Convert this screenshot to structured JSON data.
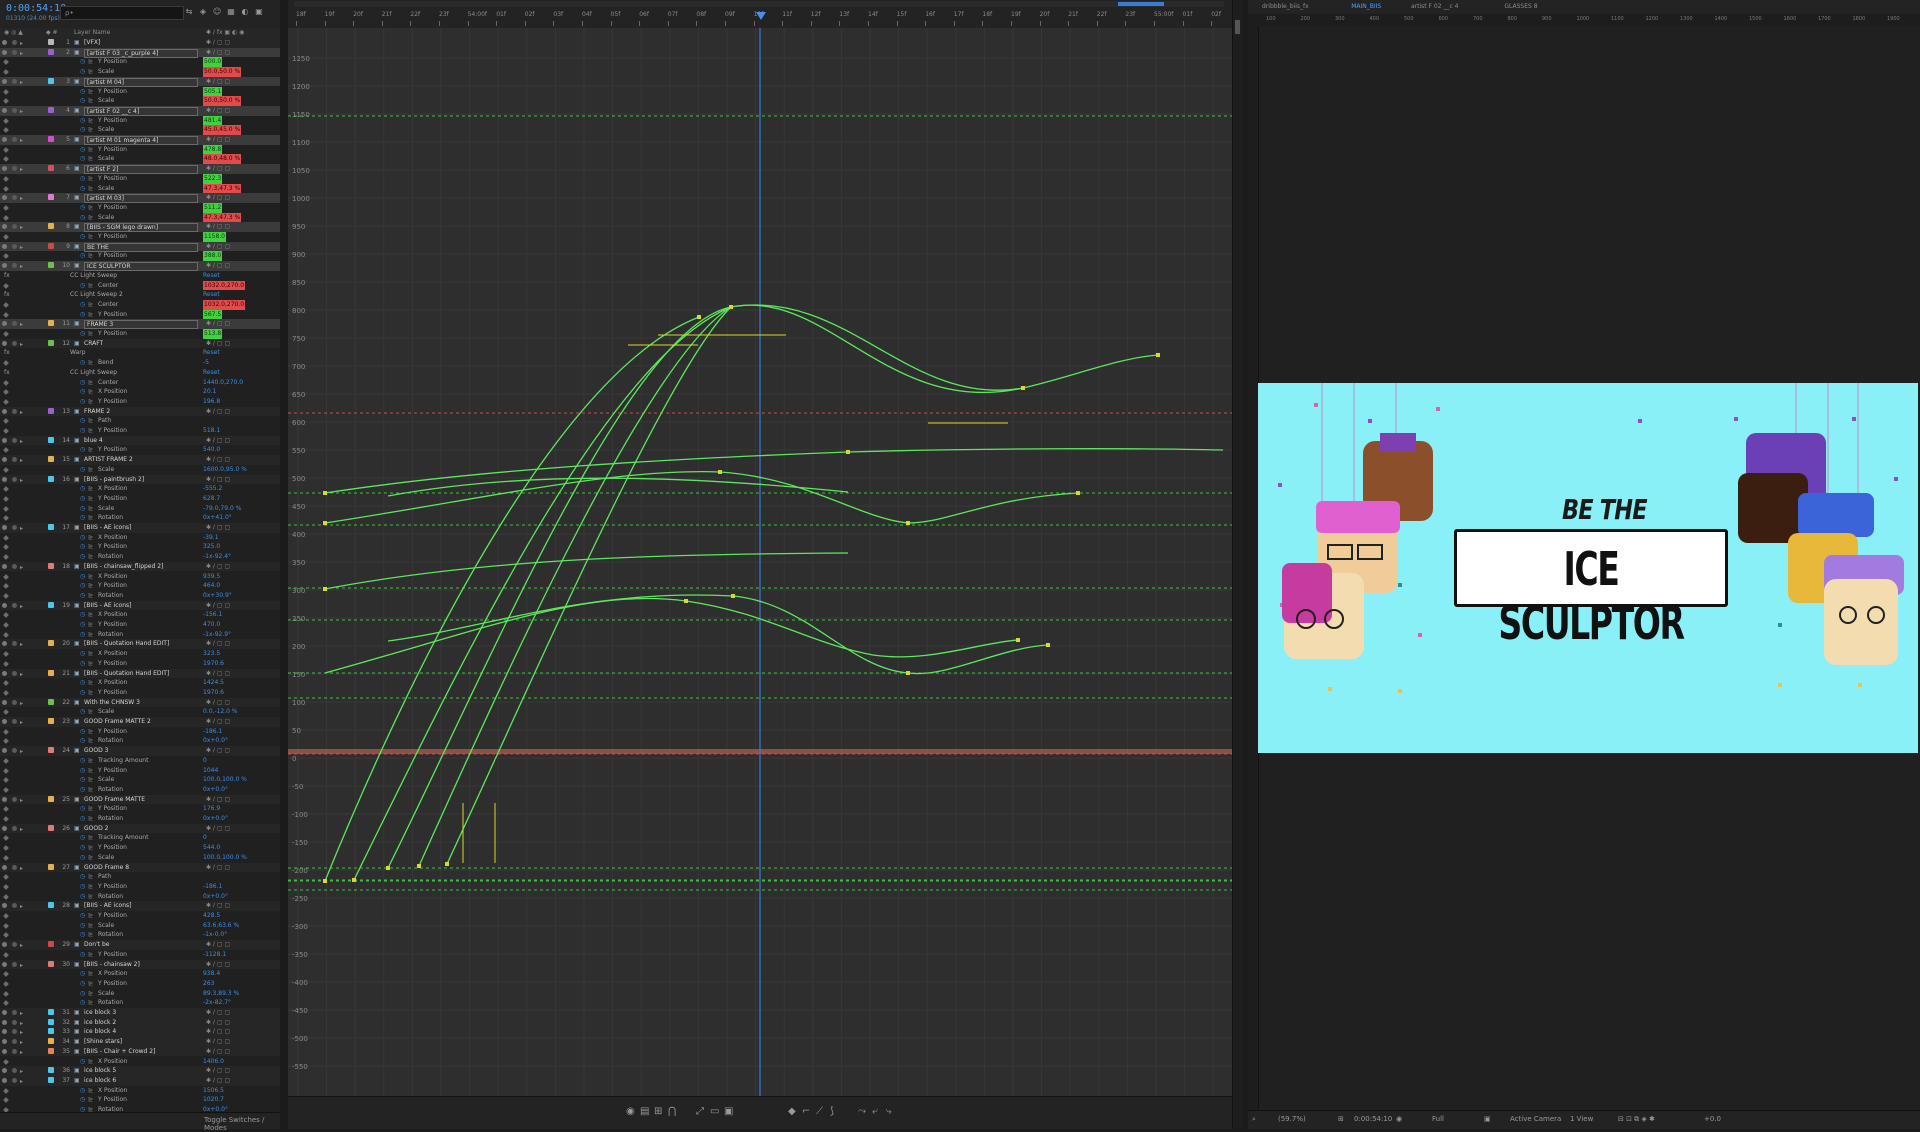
{
  "header": {
    "timecode": "0:00:54:10",
    "frame_label": "01310 (24.00 fps)",
    "search_placeholder": "ρ•",
    "column_label": "Layer Name",
    "toggle_label": "Toggle Switches / Modes"
  },
  "layers": [
    {
      "type": "layer",
      "num": "1",
      "name": "[VFX]",
      "color": "#b8b8b8",
      "boxed": false
    },
    {
      "type": "layer",
      "num": "2",
      "name": "[artist F 03 _c_purple 4]",
      "color": "#9a5fd1",
      "boxed": true,
      "sel": true
    },
    {
      "type": "prop",
      "name": "Y Position",
      "value": "500.0",
      "hl": "g"
    },
    {
      "type": "prop",
      "name": "Scale",
      "value": "50.0,50.0 %",
      "hl": "r"
    },
    {
      "type": "layer",
      "num": "3",
      "name": "[artist M 04]",
      "color": "#4dc7e8",
      "boxed": true,
      "sel": true
    },
    {
      "type": "prop",
      "name": "Y Position",
      "value": "505.1",
      "hl": "g"
    },
    {
      "type": "prop",
      "name": "Scale",
      "value": "50.0,50.0 %",
      "hl": "r"
    },
    {
      "type": "layer",
      "num": "4",
      "name": "[artist F 02 __c 4]",
      "color": "#9a5fd1",
      "boxed": true,
      "sel": true
    },
    {
      "type": "prop",
      "name": "Y Position",
      "value": "481.4",
      "hl": "g"
    },
    {
      "type": "prop",
      "name": "Scale",
      "value": "45.0,45.0 %",
      "hl": "r"
    },
    {
      "type": "layer",
      "num": "5",
      "name": "[artist M 01 magenta 4]",
      "color": "#d24fd2",
      "boxed": true,
      "sel": true
    },
    {
      "type": "prop",
      "name": "Y Position",
      "value": "478.8",
      "hl": "g"
    },
    {
      "type": "prop",
      "name": "Scale",
      "value": "48.0,48.0 %",
      "hl": "r"
    },
    {
      "type": "layer",
      "num": "6",
      "name": "[artist F 2]",
      "color": "#d14f5f",
      "boxed": true,
      "sel": true
    },
    {
      "type": "prop",
      "name": "Y Position",
      "value": "522.3",
      "hl": "g"
    },
    {
      "type": "prop",
      "name": "Scale",
      "value": "47.3,47.3 %",
      "hl": "r"
    },
    {
      "type": "layer",
      "num": "7",
      "name": "[artist M 03]",
      "color": "#e07ad2",
      "boxed": true,
      "sel": true
    },
    {
      "type": "prop",
      "name": "Y Position",
      "value": "511.2",
      "hl": "g"
    },
    {
      "type": "prop",
      "name": "Scale",
      "value": "47.3,47.3 %",
      "hl": "r"
    },
    {
      "type": "layer",
      "num": "8",
      "name": "[BIIS - SGM lego drawn]",
      "color": "#e8b04d",
      "boxed": true,
      "sel": true
    },
    {
      "type": "prop",
      "name": "Y Position",
      "value": "1158.0",
      "hl": "g"
    },
    {
      "type": "layer",
      "num": "9",
      "name": "BE THE",
      "color": "#c84a4a",
      "boxed": true,
      "sel": true
    },
    {
      "type": "prop",
      "name": "Y Position",
      "value": "388.0",
      "hl": "g"
    },
    {
      "type": "layer",
      "num": "10",
      "name": "ICE SCULPTOR",
      "color": "#6fc04b",
      "boxed": true,
      "sel": true
    },
    {
      "type": "fx",
      "name": "CC Light Sweep",
      "value": "Reset"
    },
    {
      "type": "prop",
      "name": "Center",
      "value": "1032.0,270.0",
      "hl": "rg"
    },
    {
      "type": "fx",
      "name": "CC Light Sweep 2",
      "value": "Reset"
    },
    {
      "type": "prop",
      "name": "Center",
      "value": "1032.0,270.0",
      "hl": "rg"
    },
    {
      "type": "prop",
      "name": "Y Position",
      "value": "567.5",
      "hl": "g"
    },
    {
      "type": "layer",
      "num": "11",
      "name": "FRAME 3",
      "color": "#e8b04d",
      "boxed": true,
      "sel": true
    },
    {
      "type": "prop",
      "name": "Y Position",
      "value": "513.8",
      "hl": "g"
    },
    {
      "type": "layer",
      "num": "12",
      "name": "CRAFT",
      "color": "#6fc04b",
      "boxed": false
    },
    {
      "type": "fx",
      "name": "Warp",
      "value": "Reset"
    },
    {
      "type": "prop",
      "name": "Bend",
      "value": "-5"
    },
    {
      "type": "fx",
      "name": "CC Light Sweep",
      "value": "Reset"
    },
    {
      "type": "prop",
      "name": "Center",
      "value": "1440.0,270.0"
    },
    {
      "type": "prop",
      "name": "X Position",
      "value": "20.1"
    },
    {
      "type": "prop",
      "name": "Y Position",
      "value": "196.8"
    },
    {
      "type": "layer",
      "num": "13",
      "name": "FRAME 2",
      "color": "#9a5fd1",
      "boxed": false
    },
    {
      "type": "prop",
      "name": "Path",
      "value": ""
    },
    {
      "type": "prop",
      "name": "Y Position",
      "value": "518.1"
    },
    {
      "type": "layer",
      "num": "14",
      "name": "blue 4",
      "color": "#4dc7e8",
      "boxed": false
    },
    {
      "type": "prop",
      "name": "Y Position",
      "value": "540.0"
    },
    {
      "type": "layer",
      "num": "15",
      "name": "ARTIST FRAME 2",
      "color": "#e8b04d",
      "boxed": false
    },
    {
      "type": "prop",
      "name": "Scale",
      "value": "1600.0,95.0 %"
    },
    {
      "type": "layer",
      "num": "16",
      "name": "[BIIS - paintbrush 2]",
      "color": "#4dc7e8",
      "boxed": false
    },
    {
      "type": "prop",
      "name": "X Position",
      "value": "-555.2"
    },
    {
      "type": "prop",
      "name": "Y Position",
      "value": "628.7"
    },
    {
      "type": "prop",
      "name": "Scale",
      "value": "-79.0,79.0 %"
    },
    {
      "type": "prop",
      "name": "Rotation",
      "value": "0x+41.0°"
    },
    {
      "type": "layer",
      "num": "17",
      "name": "[BIIS - AE icons]",
      "color": "#4dc7e8",
      "boxed": false
    },
    {
      "type": "prop",
      "name": "X Position",
      "value": "-39.1"
    },
    {
      "type": "prop",
      "name": "Y Position",
      "value": "325.0"
    },
    {
      "type": "prop",
      "name": "Rotation",
      "value": "-1x-92.4°"
    },
    {
      "type": "layer",
      "num": "18",
      "name": "[BIIS - chainsaw_flipped 2]",
      "color": "#e07a7a",
      "boxed": false
    },
    {
      "type": "prop",
      "name": "X Position",
      "value": "939.5"
    },
    {
      "type": "prop",
      "name": "Y Position",
      "value": "464.0"
    },
    {
      "type": "prop",
      "name": "Rotation",
      "value": "0x+30.9°"
    },
    {
      "type": "layer",
      "num": "19",
      "name": "[BIIS - AE icons]",
      "color": "#4dc7e8",
      "boxed": false
    },
    {
      "type": "prop",
      "name": "X Position",
      "value": "-156.1"
    },
    {
      "type": "prop",
      "name": "Y Position",
      "value": "470.0"
    },
    {
      "type": "prop",
      "name": "Rotation",
      "value": "-1x-92.9°"
    },
    {
      "type": "layer",
      "num": "20",
      "name": "[BIIS - Quotation Hand EDIT]",
      "color": "#e8b04d",
      "boxed": false
    },
    {
      "type": "prop",
      "name": "X Position",
      "value": "323.5"
    },
    {
      "type": "prop",
      "name": "Y Position",
      "value": "1970.6"
    },
    {
      "type": "layer",
      "num": "21",
      "name": "[BIIS - Quotation Hand EDIT]",
      "color": "#e8b04d",
      "boxed": false
    },
    {
      "type": "prop",
      "name": "X Position",
      "value": "1424.5"
    },
    {
      "type": "prop",
      "name": "Y Position",
      "value": "1970.6"
    },
    {
      "type": "layer",
      "num": "22",
      "name": "With the CHNSW 3",
      "color": "#6fc04b",
      "boxed": false
    },
    {
      "type": "prop",
      "name": "Scale",
      "value": "0.0,-12.0 %"
    },
    {
      "type": "layer",
      "num": "23",
      "name": "GOOD Frame MATTE 2",
      "color": "#e8b04d",
      "boxed": false
    },
    {
      "type": "prop",
      "name": "Y Position",
      "value": "-186.1"
    },
    {
      "type": "prop",
      "name": "Rotation",
      "value": "0x+0.0°"
    },
    {
      "type": "layer",
      "num": "24",
      "name": "GOOD 3",
      "color": "#e07a7a",
      "boxed": false
    },
    {
      "type": "prop",
      "name": "Tracking Amount",
      "value": "0"
    },
    {
      "type": "prop",
      "name": "Y Position",
      "value": "1044"
    },
    {
      "type": "prop",
      "name": "Scale",
      "value": "100.0,100.0 %"
    },
    {
      "type": "prop",
      "name": "Rotation",
      "value": "0x+0.0°"
    },
    {
      "type": "layer",
      "num": "25",
      "name": "GOOD Frame MATTE",
      "color": "#e8b04d",
      "boxed": false
    },
    {
      "type": "prop",
      "name": "Y Position",
      "value": "176.9"
    },
    {
      "type": "prop",
      "name": "Rotation",
      "value": "0x+0.0°"
    },
    {
      "type": "layer",
      "num": "26",
      "name": "GOOD 2",
      "color": "#e07a7a",
      "boxed": false
    },
    {
      "type": "prop",
      "name": "Tracking Amount",
      "value": "0"
    },
    {
      "type": "prop",
      "name": "Y Position",
      "value": "544.0"
    },
    {
      "type": "prop",
      "name": "Scale",
      "value": "100.0,100.0 %"
    },
    {
      "type": "layer",
      "num": "27",
      "name": "GOOD Frame 8",
      "color": "#e8b04d",
      "boxed": false
    },
    {
      "type": "prop",
      "name": "Path",
      "value": ""
    },
    {
      "type": "prop",
      "name": "Y Position",
      "value": "-186.1"
    },
    {
      "type": "prop",
      "name": "Rotation",
      "value": "0x+0.0°"
    },
    {
      "type": "layer",
      "num": "28",
      "name": "[BIIS - AE icons]",
      "color": "#4dc7e8",
      "boxed": false
    },
    {
      "type": "prop",
      "name": "Y Position",
      "value": "428.5"
    },
    {
      "type": "prop",
      "name": "Scale",
      "value": "63.6,63.6 %"
    },
    {
      "type": "prop",
      "name": "Rotation",
      "value": "-1x-0.0°"
    },
    {
      "type": "layer",
      "num": "29",
      "name": "Don't be",
      "color": "#c84a4a",
      "boxed": false
    },
    {
      "type": "prop",
      "name": "Y Position",
      "value": "-1128.1"
    },
    {
      "type": "layer",
      "num": "30",
      "name": "[BIIS - chainsaw 2]",
      "color": "#e07a7a",
      "boxed": false
    },
    {
      "type": "prop",
      "name": "X Position",
      "value": "938.4"
    },
    {
      "type": "prop",
      "name": "Y Position",
      "value": "263"
    },
    {
      "type": "prop",
      "name": "Scale",
      "value": "89.3,89.3 %"
    },
    {
      "type": "prop",
      "name": "Rotation",
      "value": "-2x-82.7°"
    },
    {
      "type": "layer",
      "num": "31",
      "name": "ice block 3",
      "color": "#4dc7e8",
      "boxed": false
    },
    {
      "type": "layer",
      "num": "32",
      "name": "ice block 2",
      "color": "#4dc7e8",
      "boxed": false
    },
    {
      "type": "layer",
      "num": "33",
      "name": "ice block 4",
      "color": "#4dc7e8",
      "boxed": false
    },
    {
      "type": "layer",
      "num": "34",
      "name": "[Shine stars]",
      "color": "#e8b04d",
      "boxed": false
    },
    {
      "type": "layer",
      "num": "35",
      "name": "[BIIS - Chair + Crowd 2]",
      "color": "#e8844d",
      "boxed": false
    },
    {
      "type": "prop",
      "name": "X Position",
      "value": "1406.0"
    },
    {
      "type": "layer",
      "num": "36",
      "name": "ice block 5",
      "color": "#4dc7e8",
      "boxed": false
    },
    {
      "type": "layer",
      "num": "37",
      "name": "ice block 6",
      "color": "#4dc7e8",
      "boxed": false
    },
    {
      "type": "prop",
      "name": "X Position",
      "value": "1506.5"
    },
    {
      "type": "prop",
      "name": "Y Position",
      "value": "1020.7"
    },
    {
      "type": "prop",
      "name": "Rotation",
      "value": "0x+0.0°"
    }
  ],
  "ruler_ticks": [
    "18f",
    "19f",
    "20f",
    "21f",
    "22f",
    "23f",
    "54:00f",
    "01f",
    "02f",
    "03f",
    "04f",
    "05f",
    "06f",
    "07f",
    "08f",
    "09f",
    "10f",
    "11f",
    "12f",
    "13f",
    "14f",
    "15f",
    "16f",
    "17f",
    "18f",
    "19f",
    "20f",
    "21f",
    "22f",
    "23f",
    "55:00f",
    "01f",
    "02f"
  ],
  "y_axis_ticks": [
    "1250",
    "1200",
    "1150",
    "1100",
    "1050",
    "1000",
    "950",
    "900",
    "850",
    "800",
    "750",
    "700",
    "650",
    "600",
    "550",
    "500",
    "450",
    "400",
    "350",
    "300",
    "250",
    "200",
    "150",
    "100",
    "50",
    "0",
    "-50",
    "-100",
    "-150",
    "-200",
    "-250",
    "-300",
    "-350",
    "-400",
    "-450",
    "-500",
    "-550"
  ],
  "comp": {
    "tabs": [
      "dribbble_biis_fx",
      "MAIN_BIIS",
      "artist F 02 __c 4",
      "GLASSES 8"
    ],
    "ruler_ticks": [
      "100",
      "200",
      "300",
      "400",
      "500",
      "600",
      "700",
      "800",
      "900",
      "1000",
      "1100",
      "1200",
      "1300",
      "1400",
      "1500",
      "1600",
      "1700",
      "1800",
      "1900"
    ],
    "headline_small": "BE THE",
    "headline_large": "ICE SCULPTOR",
    "background_color": "#8af0f7",
    "footer": {
      "zoom": "(59.7%)",
      "time": "0:00:54:10",
      "resolution": "Full",
      "camera": "Active Camera",
      "views": "1 View",
      "exposure": "+0.0"
    }
  },
  "colors": {
    "accent": "#4aa3ff",
    "curve": "#5ce85c",
    "playhead": "#3a7bd5",
    "keyframe": "#d8d82e"
  }
}
